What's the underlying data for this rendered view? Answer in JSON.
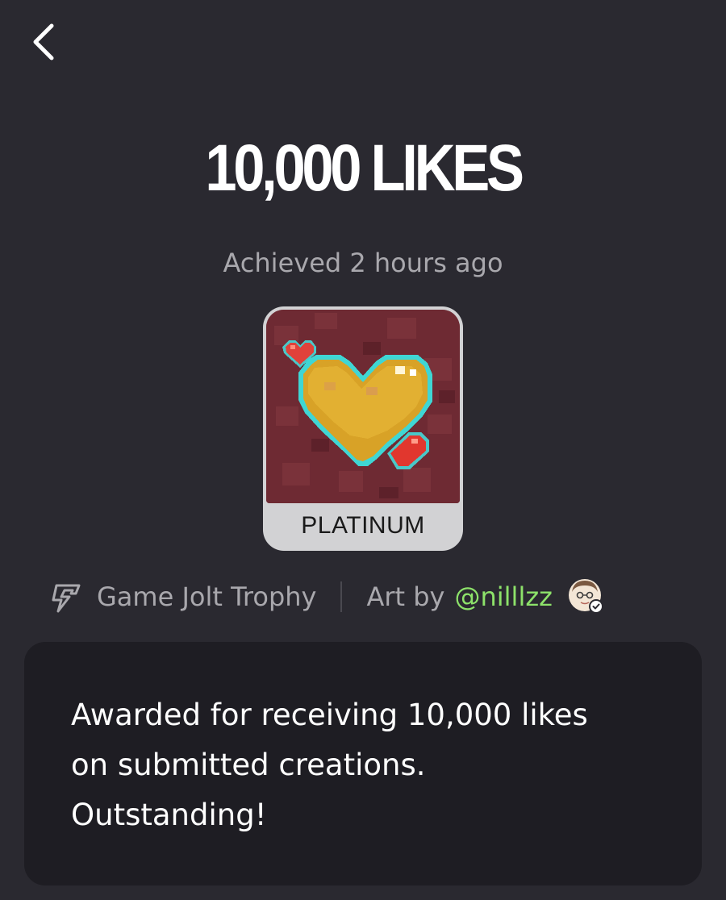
{
  "header": {
    "back_icon": "chevron-left-icon"
  },
  "trophy": {
    "title": "10,000 LIKES",
    "achieved": "Achieved 2 hours ago",
    "tier": "PLATINUM",
    "art_icon": "pixel-heart-trophy-art"
  },
  "meta": {
    "source_icon": "game-jolt-icon",
    "source_label": "Game Jolt Trophy",
    "art_by_label": "Art by",
    "artist_handle": "@nilllzz",
    "artist_avatar": "artist-avatar-verified",
    "artist_color": "#8de26a"
  },
  "description": {
    "text": "Awarded for receiving 10,000 likes on submitted creations. Outstanding!"
  },
  "colors": {
    "background": "#2a2930",
    "panel": "#1e1d23",
    "muted_text": "#a9a8ad"
  }
}
